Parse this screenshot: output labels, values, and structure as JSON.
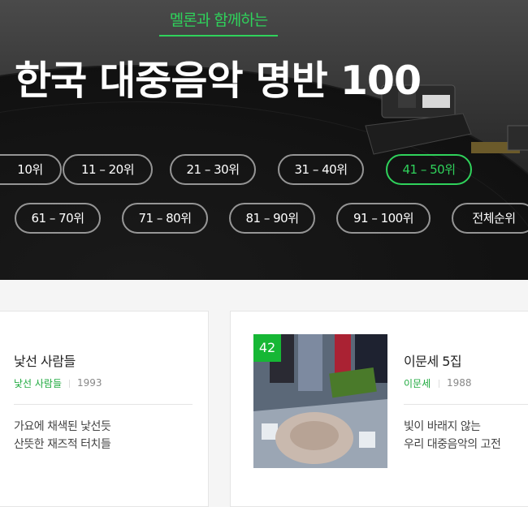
{
  "hero": {
    "subtitle": "멜론과 함께하는",
    "title": "한국 대중음악 명반 100"
  },
  "rank_tabs": {
    "row1": [
      {
        "label": "10위",
        "active": false
      },
      {
        "label": "11 – 20위",
        "active": false
      },
      {
        "label": "21 – 30위",
        "active": false
      },
      {
        "label": "31 – 40위",
        "active": false
      },
      {
        "label": "41 – 50위",
        "active": true
      }
    ],
    "row2": [
      {
        "label": "61 – 70위",
        "active": false
      },
      {
        "label": "71 – 80위",
        "active": false
      },
      {
        "label": "81 – 90위",
        "active": false
      },
      {
        "label": "91 – 100위",
        "active": false
      },
      {
        "label": "전체순위",
        "active": false
      }
    ]
  },
  "albums": [
    {
      "title": "낯선 사람들",
      "artist": "낯선 사람들",
      "year": "1993",
      "desc_line1": "가요에 채색된 낯선듯",
      "desc_line2": "산뜻한 재즈적 터치들"
    },
    {
      "rank": "42",
      "title": "이문세 5집",
      "artist": "이문세",
      "year": "1988",
      "desc_line1": "빛이 바래지 않는",
      "desc_line2": "우리 대중음악의 고전"
    }
  ],
  "colors": {
    "accent": "#2fd25b",
    "badge": "#16b735",
    "artist_text": "#1faa3f"
  }
}
